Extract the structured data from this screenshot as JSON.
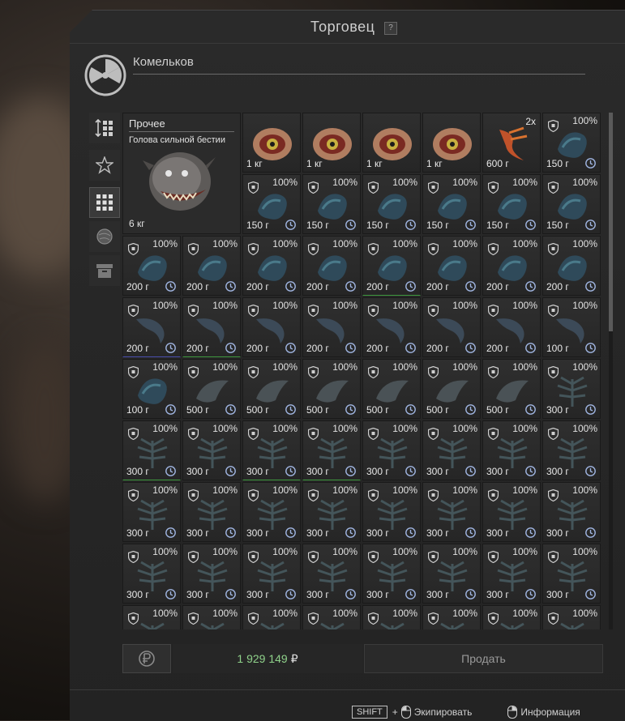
{
  "window": {
    "title": "Торговец",
    "help_label": "?"
  },
  "trader": {
    "name": "Комельков"
  },
  "sidebar": {
    "items": [
      {
        "icon": "sort-icon",
        "active": false
      },
      {
        "icon": "star-icon",
        "active": false
      },
      {
        "icon": "grid-icon",
        "active": true
      },
      {
        "icon": "artifact-icon",
        "active": false
      },
      {
        "icon": "box-icon",
        "active": false
      }
    ]
  },
  "selected_item": {
    "category": "Прочее",
    "name": "Голова сильной бестии",
    "weight": "6 кг"
  },
  "rows": [
    [
      {
        "weight": "1 кг",
        "art": "eye"
      },
      {
        "weight": "1 кг",
        "art": "eye"
      },
      {
        "weight": "1 кг",
        "art": "eye"
      },
      {
        "weight": "1 кг",
        "art": "eye"
      },
      {
        "weight": "600 г",
        "art": "claw",
        "count": "2x"
      },
      {
        "weight": "150 г",
        "art": "blue",
        "pct": "100%"
      }
    ],
    [
      {
        "weight": "150 г",
        "art": "blue",
        "pct": "100%"
      },
      {
        "weight": "150 г",
        "art": "blue",
        "pct": "100%"
      },
      {
        "weight": "150 г",
        "art": "blue",
        "pct": "100%"
      },
      {
        "weight": "150 г",
        "art": "blue",
        "pct": "100%"
      },
      {
        "weight": "150 г",
        "art": "blue",
        "pct": "100%"
      },
      {
        "weight": "150 г",
        "art": "blue",
        "pct": "100%"
      }
    ],
    [
      {
        "weight": "200 г",
        "art": "blue",
        "pct": "100%"
      },
      {
        "weight": "200 г",
        "art": "blue",
        "pct": "100%"
      },
      {
        "weight": "200 г",
        "art": "blue",
        "pct": "100%"
      },
      {
        "weight": "200 г",
        "art": "blue",
        "pct": "100%"
      },
      {
        "weight": "200 г",
        "art": "blue",
        "pct": "100%",
        "line": "green"
      },
      {
        "weight": "200 г",
        "art": "blue",
        "pct": "100%"
      },
      {
        "weight": "200 г",
        "art": "blue",
        "pct": "100%"
      },
      {
        "weight": "200 г",
        "art": "blue",
        "pct": "100%"
      }
    ],
    [
      {
        "weight": "200 г",
        "art": "claw2",
        "pct": "100%",
        "line": "blue"
      },
      {
        "weight": "200 г",
        "art": "claw2",
        "pct": "100%",
        "line": "green"
      },
      {
        "weight": "200 г",
        "art": "claw2",
        "pct": "100%"
      },
      {
        "weight": "200 г",
        "art": "claw2",
        "pct": "100%"
      },
      {
        "weight": "200 г",
        "art": "claw2",
        "pct": "100%"
      },
      {
        "weight": "200 г",
        "art": "claw2",
        "pct": "100%"
      },
      {
        "weight": "200 г",
        "art": "claw2",
        "pct": "100%"
      },
      {
        "weight": "100 г",
        "art": "claw2",
        "pct": "100%"
      }
    ],
    [
      {
        "weight": "100 г",
        "art": "blue",
        "pct": "100%"
      },
      {
        "weight": "500 г",
        "art": "grey",
        "pct": "100%"
      },
      {
        "weight": "500 г",
        "art": "grey",
        "pct": "100%"
      },
      {
        "weight": "500 г",
        "art": "grey",
        "pct": "100%"
      },
      {
        "weight": "500 г",
        "art": "grey",
        "pct": "100%"
      },
      {
        "weight": "500 г",
        "art": "grey",
        "pct": "100%"
      },
      {
        "weight": "500 г",
        "art": "grey",
        "pct": "100%"
      },
      {
        "weight": "300 г",
        "art": "fern",
        "pct": "100%"
      }
    ],
    [
      {
        "weight": "300 г",
        "art": "fern",
        "pct": "100%",
        "line": "green"
      },
      {
        "weight": "300 г",
        "art": "fern",
        "pct": "100%"
      },
      {
        "weight": "300 г",
        "art": "fern",
        "pct": "100%",
        "line": "green"
      },
      {
        "weight": "300 г",
        "art": "fern",
        "pct": "100%",
        "line": "green"
      },
      {
        "weight": "300 г",
        "art": "fern",
        "pct": "100%"
      },
      {
        "weight": "300 г",
        "art": "fern",
        "pct": "100%"
      },
      {
        "weight": "300 г",
        "art": "fern",
        "pct": "100%"
      },
      {
        "weight": "300 г",
        "art": "fern",
        "pct": "100%"
      }
    ],
    [
      {
        "weight": "300 г",
        "art": "fern",
        "pct": "100%"
      },
      {
        "weight": "300 г",
        "art": "fern",
        "pct": "100%"
      },
      {
        "weight": "300 г",
        "art": "fern",
        "pct": "100%"
      },
      {
        "weight": "300 г",
        "art": "fern",
        "pct": "100%"
      },
      {
        "weight": "300 г",
        "art": "fern",
        "pct": "100%"
      },
      {
        "weight": "300 г",
        "art": "fern",
        "pct": "100%"
      },
      {
        "weight": "300 г",
        "art": "fern",
        "pct": "100%"
      },
      {
        "weight": "300 г",
        "art": "fern",
        "pct": "100%"
      }
    ],
    [
      {
        "weight": "300 г",
        "art": "fern",
        "pct": "100%"
      },
      {
        "weight": "300 г",
        "art": "fern",
        "pct": "100%"
      },
      {
        "weight": "300 г",
        "art": "fern",
        "pct": "100%"
      },
      {
        "weight": "300 г",
        "art": "fern",
        "pct": "100%"
      },
      {
        "weight": "300 г",
        "art": "fern",
        "pct": "100%"
      },
      {
        "weight": "300 г",
        "art": "fern",
        "pct": "100%"
      },
      {
        "weight": "300 г",
        "art": "fern",
        "pct": "100%"
      },
      {
        "weight": "300 г",
        "art": "fern",
        "pct": "100%"
      }
    ],
    [
      {
        "weight": "",
        "art": "fern",
        "pct": "100%"
      },
      {
        "weight": "",
        "art": "fern",
        "pct": "100%"
      },
      {
        "weight": "",
        "art": "fern",
        "pct": "100%"
      },
      {
        "weight": "",
        "art": "fern",
        "pct": "100%"
      },
      {
        "weight": "",
        "art": "fern",
        "pct": "100%"
      },
      {
        "weight": "",
        "art": "fern",
        "pct": "100%"
      },
      {
        "weight": "",
        "art": "fern",
        "pct": "100%"
      },
      {
        "weight": "",
        "art": "fern",
        "pct": "100%"
      }
    ]
  ],
  "footer": {
    "money": "1 929 149",
    "currency": "₽",
    "sell_label": "Продать"
  },
  "hints": {
    "shift_key": "SHIFT",
    "plus": "+",
    "equip_label": "Экипировать",
    "info_label": "Информация"
  },
  "colors": {
    "money": "#8fd18a",
    "blue_line": "#4a4fb0",
    "green_line": "#3f9a3f"
  }
}
